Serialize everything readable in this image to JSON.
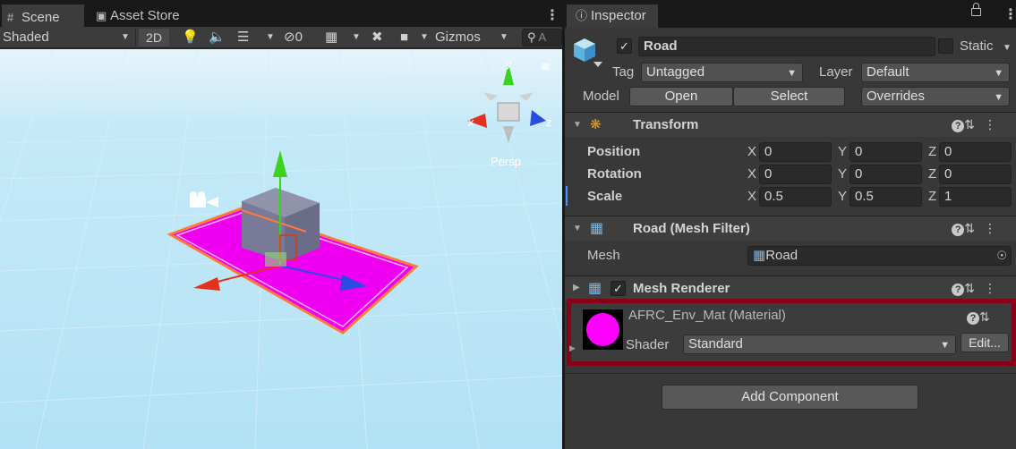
{
  "scene_panel": {
    "tabs": [
      {
        "label": "Scene",
        "icon": "grid-icon"
      },
      {
        "label": "Asset Store",
        "icon": "shopping-bag-icon"
      }
    ],
    "toolbar": {
      "draw_mode": "Shaded",
      "mode_2d": "2D",
      "hidden_count": "0",
      "gizmos": "Gizmos",
      "search_placeholder": "A"
    },
    "gizmo": {
      "y_label": "y",
      "x_label": "x",
      "z_label": "z",
      "projection": "Persp"
    }
  },
  "inspector": {
    "tab_label": "Inspector",
    "object": {
      "name": "Road",
      "active": true,
      "static_label": "Static",
      "static": false,
      "tag_label": "Tag",
      "tag_value": "Untagged",
      "layer_label": "Layer",
      "layer_value": "Default",
      "model_label": "Model",
      "open_label": "Open",
      "select_label": "Select",
      "overrides_label": "Overrides"
    },
    "transform": {
      "title": "Transform",
      "rows": [
        {
          "label": "Position",
          "x": "0",
          "y": "0",
          "z": "0"
        },
        {
          "label": "Rotation",
          "x": "0",
          "y": "0",
          "z": "0"
        },
        {
          "label": "Scale",
          "x": "0.5",
          "y": "0.5",
          "z": "1"
        }
      ],
      "axis_x": "X",
      "axis_y": "Y",
      "axis_z": "Z"
    },
    "mesh_filter": {
      "title": "Road (Mesh Filter)",
      "mesh_label": "Mesh",
      "mesh_value": "Road"
    },
    "mesh_renderer": {
      "title": "Mesh Renderer",
      "enabled": true
    },
    "material": {
      "name": "AFRC_Env_Mat (Material)",
      "shader_label": "Shader",
      "shader_value": "Standard",
      "edit_label": "Edit...",
      "preview_color": "#ff00ff"
    },
    "add_component_label": "Add Component"
  },
  "colors": {
    "selection_outline": "#ff7a3c",
    "material_highlight": "#880017",
    "x_axis": "#e0321e",
    "y_axis": "#3ad21e",
    "z_axis": "#2a4ce0"
  }
}
